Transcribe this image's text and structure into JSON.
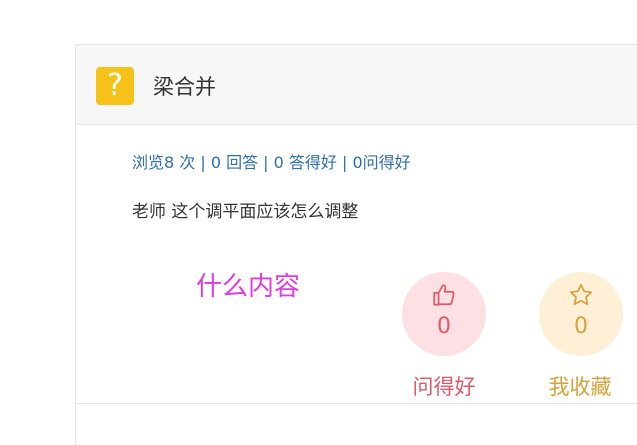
{
  "header": {
    "icon": "question-mark-icon",
    "icon_glyph": "?",
    "title": "梁合并"
  },
  "stats": {
    "line": "浏览8 次 | 0 回答 | 0 答得好 | 0问得好"
  },
  "question": {
    "text": "老师 这个调平面应该怎么调整"
  },
  "annotation": {
    "text": "什么内容"
  },
  "actions": {
    "like": {
      "icon": "thumbs-up-icon",
      "count": "0",
      "label": "问得好"
    },
    "favorite": {
      "icon": "star-icon",
      "count": "0",
      "label": "我收藏"
    }
  },
  "colors": {
    "icon_bg": "#f6c21a",
    "link_blue": "#2d6fb0",
    "like_red": "#df5a6a",
    "like_bg": "#fde0e3",
    "fav_orange": "#d8a23a",
    "fav_bg": "#fdf0d6",
    "annotation_magenta": "#e23ae0"
  }
}
